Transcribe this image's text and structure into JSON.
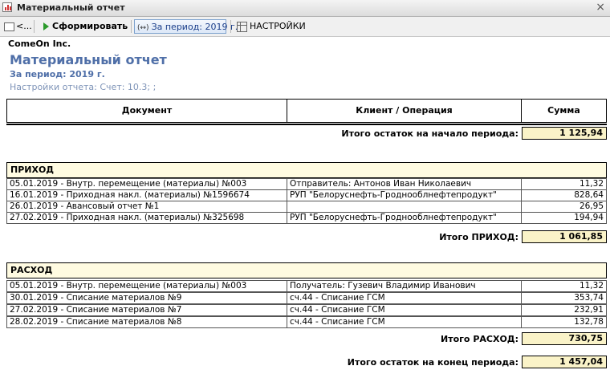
{
  "window": {
    "title": "Материальный отчет"
  },
  "toolbar": {
    "back_label": "<...",
    "generate_label": "Сформировать",
    "period_label": "За период: 2019 г.",
    "settings_label": "НАСТРОЙКИ"
  },
  "report": {
    "company": "ComeOn Inc.",
    "title": "Материальный отчет",
    "period": "За период: 2019 г.",
    "settings": "Настройки отчета: Счет: 10.3; ;"
  },
  "columns": {
    "document": "Документ",
    "client": "Клиент / Операция",
    "sum": "Сумма"
  },
  "opening": {
    "label": "Итого остаток на начало периода:",
    "value": "1 125,94"
  },
  "income": {
    "title": "ПРИХОД",
    "rows": [
      {
        "document": "05.01.2019 - Внутр. перемещение (материалы) №003",
        "client": "Отправитель: Антонов Иван Николаевич",
        "sum": "11,32"
      },
      {
        "document": "16.01.2019 - Приходная накл. (материалы) №1596674",
        "client": "РУП  \"Белоруснефть-Гродноoблнефтепродукт\"",
        "sum": "828,64"
      },
      {
        "document": "26.01.2019 - Авансовый отчет №1",
        "client": "",
        "sum": "26,95"
      },
      {
        "document": "27.02.2019 - Приходная накл. (материалы) №325698",
        "client": "РУП  \"Белоруснефть-Гродноoблнефтепродукт\"",
        "sum": "194,94"
      }
    ],
    "total_label": "Итого ПРИХОД:",
    "total_value": "1 061,85"
  },
  "expense": {
    "title": "РАСХОД",
    "rows": [
      {
        "document": "05.01.2019 - Внутр. перемещение (материалы) №003",
        "client": "Получатель: Гузевич Владимир Иванович",
        "sum": "11,32"
      },
      {
        "document": "30.01.2019 - Списание материалов №9",
        "client": "сч.44 - Списание ГСМ",
        "sum": "353,74"
      },
      {
        "document": "27.02.2019 - Списание материалов №7",
        "client": "сч.44 - Списание ГСМ",
        "sum": "232,91"
      },
      {
        "document": "28.02.2019 - Списание материалов №8",
        "client": "сч.44 - Списание ГСМ",
        "sum": "132,78"
      }
    ],
    "total_label": "Итого РАСХОД:",
    "total_value": "730,75"
  },
  "closing": {
    "label": "Итого остаток на конец периода:",
    "value": "1 457,04"
  }
}
